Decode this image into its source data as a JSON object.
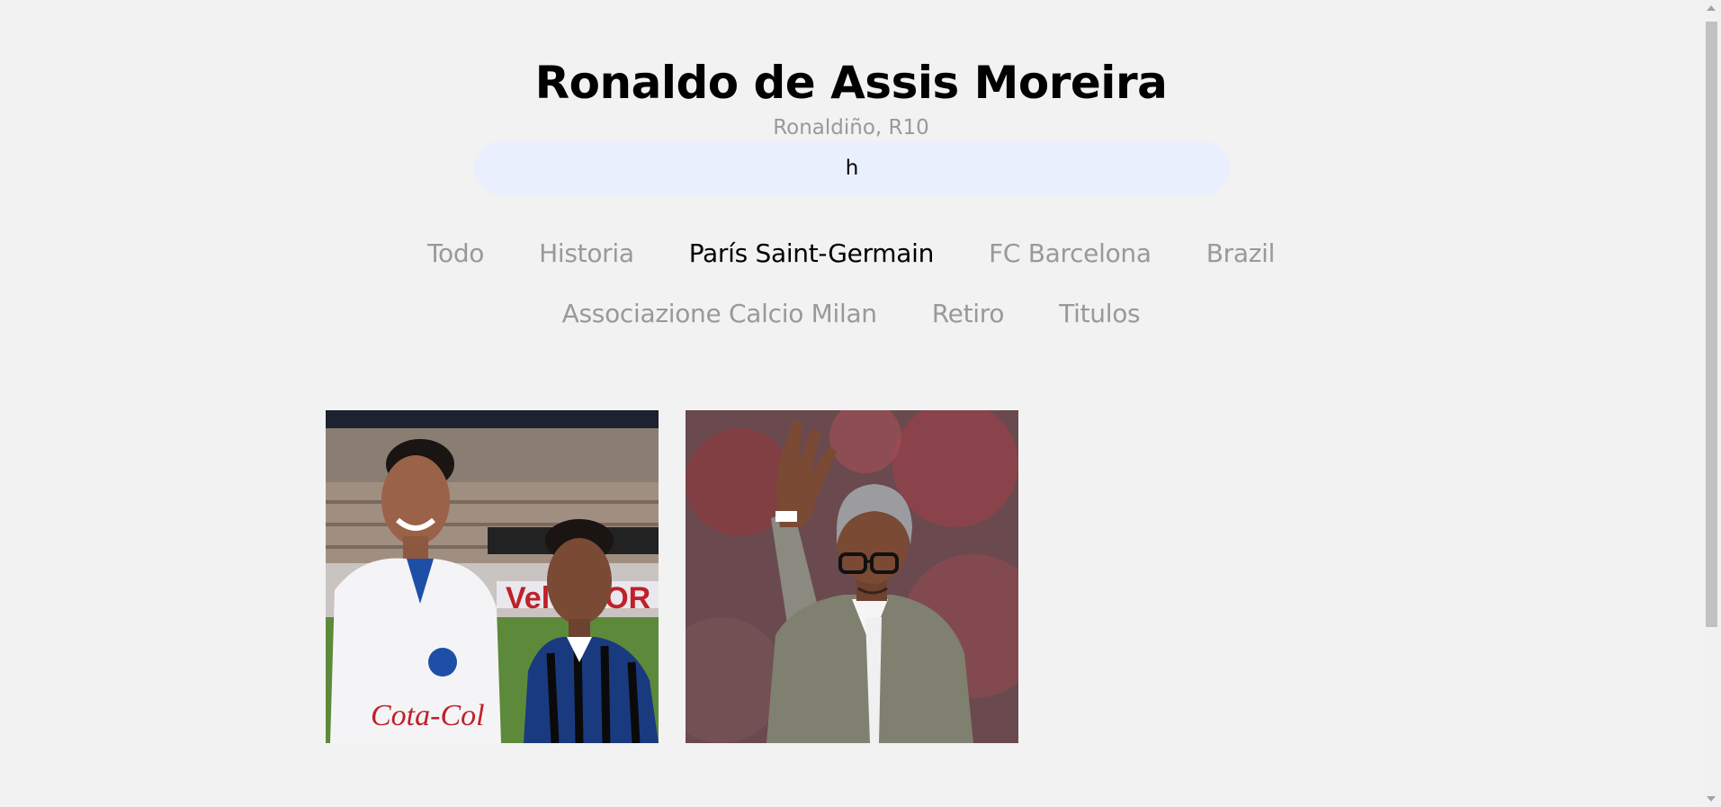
{
  "header": {
    "title": "Ronaldo de Assis Moreira",
    "subtitle": "Ronaldiño, R10"
  },
  "search": {
    "value": "h"
  },
  "filters": {
    "row1": [
      "Todo",
      "Historia",
      "París Saint-Germain",
      "FC Barcelona",
      "Brazil"
    ],
    "row2": [
      "Associazione Calcio Milan",
      "Retiro",
      "Titulos"
    ],
    "active": "París Saint-Germain"
  },
  "colors": {
    "background": "#f2f2f2",
    "search_bg": "#e9effc",
    "inactive_filter": "#999999",
    "active_filter": "#000000"
  }
}
